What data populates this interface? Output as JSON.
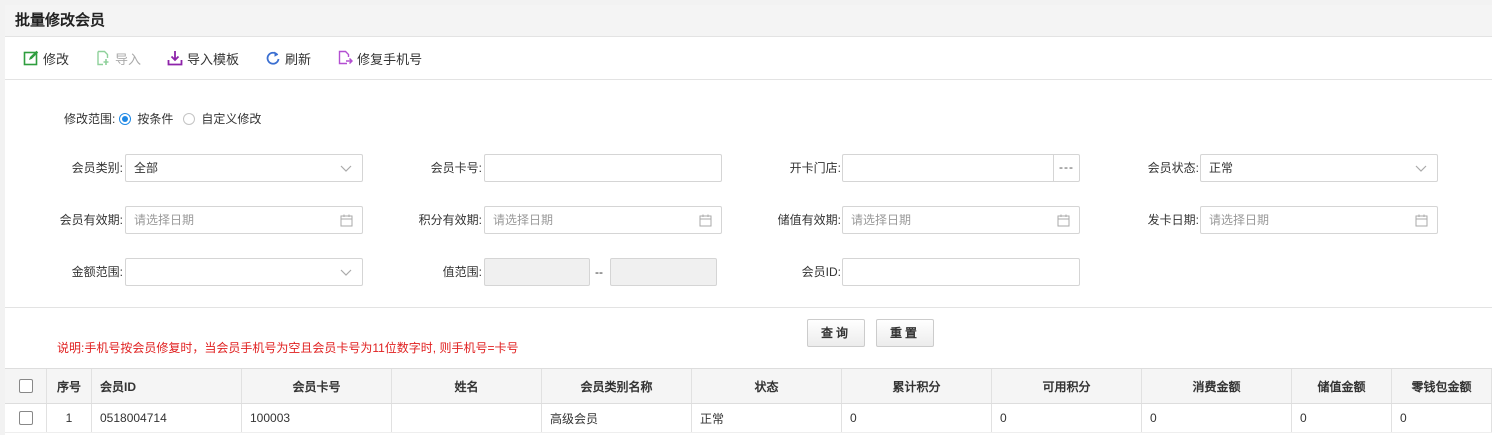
{
  "page": {
    "title": "批量修改会员"
  },
  "toolbar": {
    "modify": "修改",
    "import": "导入",
    "import_template": "导入模板",
    "refresh": "刷新",
    "repair_phone": "修复手机号"
  },
  "scope": {
    "label": "修改范围:",
    "options": [
      {
        "label": "按条件",
        "checked": true
      },
      {
        "label": "自定义修改",
        "checked": false
      }
    ]
  },
  "filters": {
    "member_type": {
      "label": "会员类别:",
      "value": "全部"
    },
    "member_card": {
      "label": "会员卡号:",
      "value": ""
    },
    "open_store": {
      "label": "开卡门店:",
      "value": "",
      "button": "---"
    },
    "member_status": {
      "label": "会员状态:",
      "value": "正常"
    },
    "member_valid": {
      "label": "会员有效期:",
      "placeholder": "请选择日期"
    },
    "points_valid": {
      "label": "积分有效期:",
      "placeholder": "请选择日期"
    },
    "stored_valid": {
      "label": "储值有效期:",
      "placeholder": "请选择日期"
    },
    "issue_date": {
      "label": "发卡日期:",
      "placeholder": "请选择日期"
    },
    "amount_range": {
      "label": "金额范围:",
      "value": ""
    },
    "value_range": {
      "label": "值范围:",
      "from": "",
      "to": "",
      "separator": "--"
    },
    "member_id": {
      "label": "会员ID:",
      "value": ""
    }
  },
  "actions": {
    "query": "查询",
    "reset": "重置"
  },
  "note": "说明:手机号按会员修复时，当会员手机号为空且会员卡号为11位数字时, 则手机号=卡号",
  "table": {
    "columns": [
      "序号",
      "会员ID",
      "会员卡号",
      "姓名",
      "会员类别名称",
      "状态",
      "累计积分",
      "可用积分",
      "消费金额",
      "储值金额",
      "零钱包金额"
    ],
    "rows": [
      {
        "index": "1",
        "member_id": "0518004714",
        "card_no": "100003",
        "name": "",
        "category": "高级会员",
        "status": "正常",
        "total_points": "0",
        "avail_points": "0",
        "consume_amount": "0",
        "stored_amount": "0",
        "wallet_amount": "0"
      }
    ]
  },
  "colors": {
    "accent": "#1e88e5",
    "note_red": "#e02020",
    "icon_green": "#2e9e3e",
    "icon_purple": "#8e24aa",
    "icon_blue": "#3b6fd1"
  }
}
